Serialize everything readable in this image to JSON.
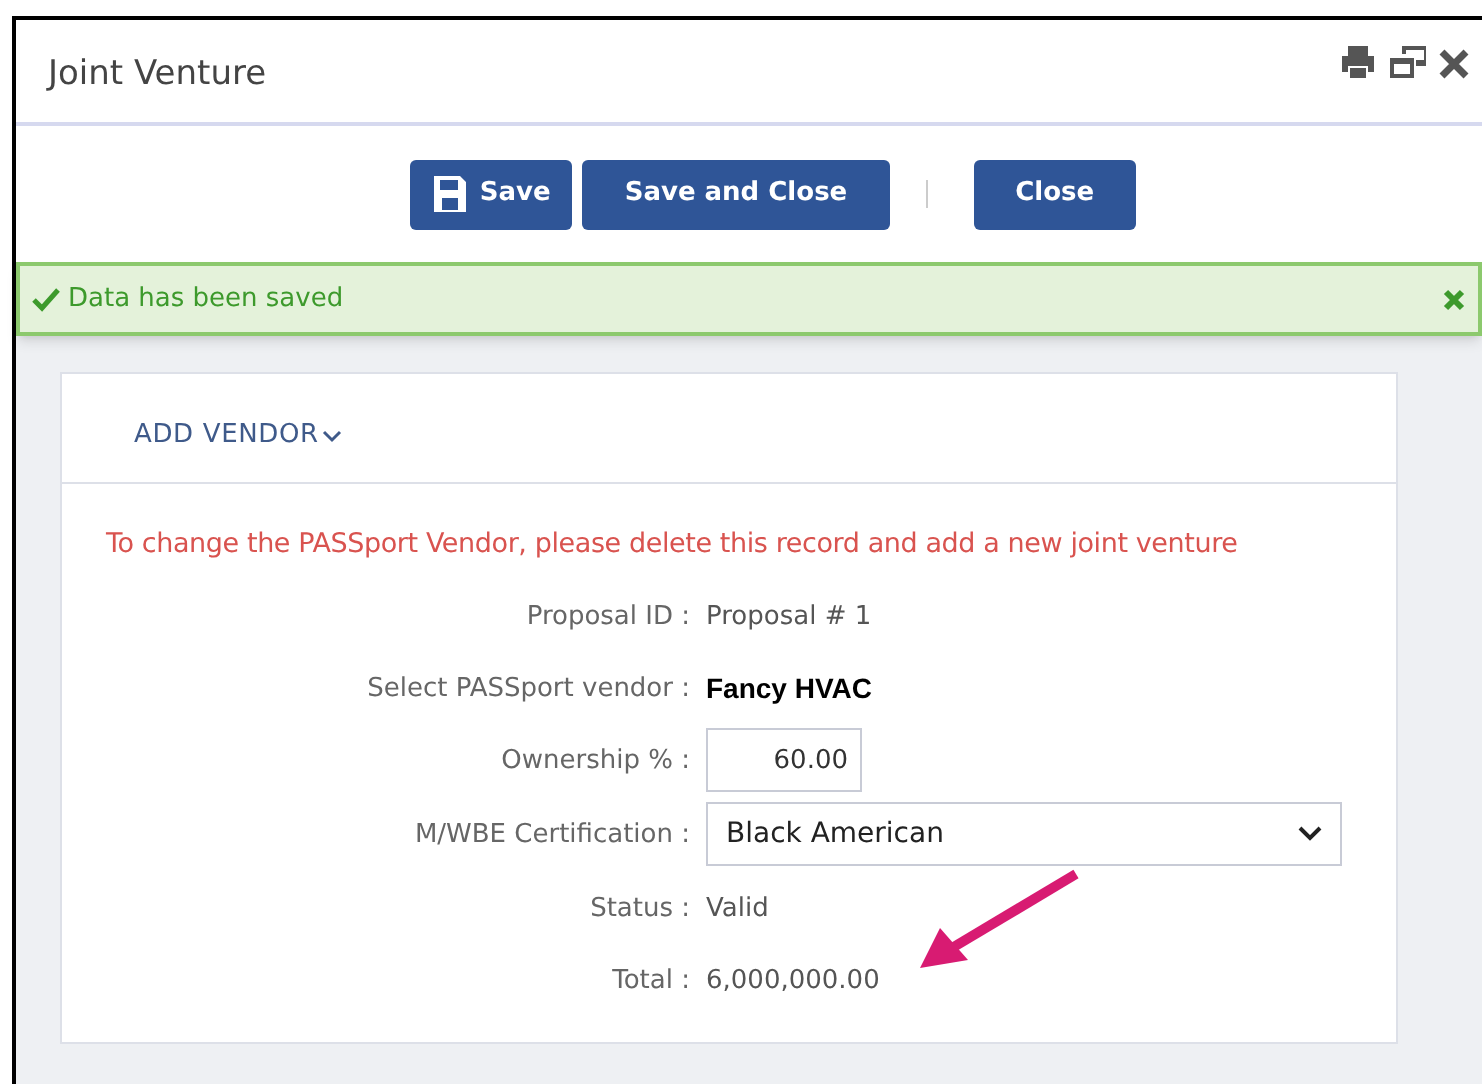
{
  "window": {
    "title": "Joint Venture"
  },
  "toolbar": {
    "buttons": [
      {
        "label": "Save",
        "kind": "save"
      },
      {
        "label": "Save and Close",
        "kind": "plain"
      },
      {
        "label": "Close",
        "kind": "plain"
      }
    ]
  },
  "alert": {
    "message": "Data has been saved"
  },
  "card": {
    "menu": "ADD VENDOR",
    "warning": "To change the PASSport Vendor, please delete this record and add a new joint venture",
    "fields": [
      {
        "label": "Proposal ID :",
        "value": "Proposal # 1",
        "kind": "text"
      },
      {
        "label": "Select PASSport vendor :",
        "value": "Fancy HVAC",
        "kind": "bold"
      },
      {
        "label": "Ownership % :",
        "value": "60.00",
        "kind": "input"
      },
      {
        "label": "M/WBE Certification :",
        "value": "Black American",
        "kind": "select"
      },
      {
        "label": "Status :",
        "value": "Valid",
        "kind": "text"
      },
      {
        "label": "Total :",
        "value": "6,000,000.00",
        "kind": "text"
      }
    ]
  }
}
